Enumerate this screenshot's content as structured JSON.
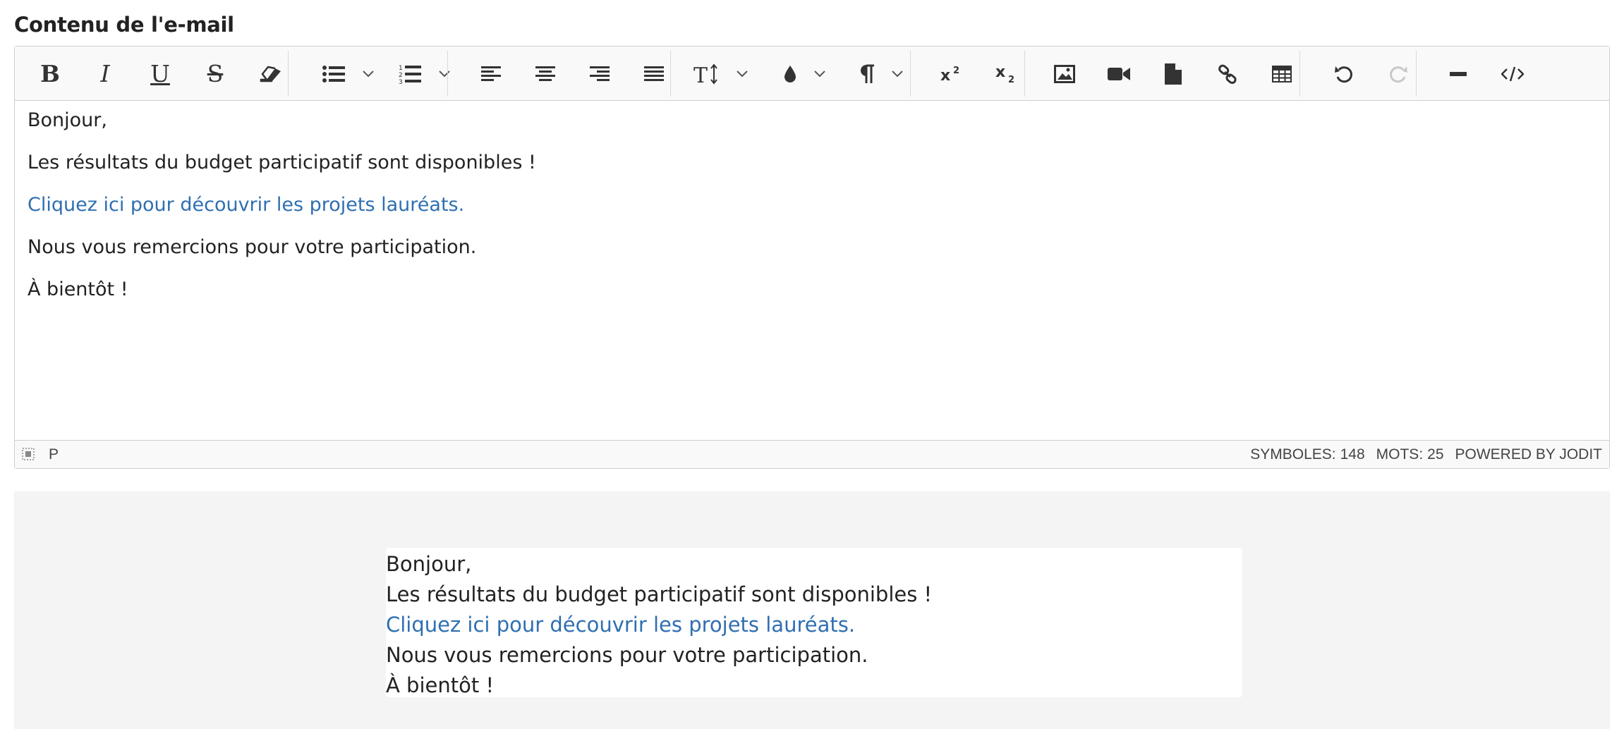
{
  "field": {
    "label": "Contenu de l'e-mail"
  },
  "toolbar": {
    "buttons": [
      {
        "name": "bold-button",
        "icon": "bold-icon",
        "glyph": "B"
      },
      {
        "name": "italic-button",
        "icon": "italic-icon",
        "glyph": "I"
      },
      {
        "name": "underline-button",
        "icon": "underline-icon",
        "glyph": "U"
      },
      {
        "name": "strikethrough-button",
        "icon": "strikethrough-icon",
        "glyph": "S"
      },
      {
        "name": "eraser-button",
        "icon": "eraser-icon"
      },
      {
        "name": "bullet-list-button",
        "icon": "bullet-list-icon",
        "dropdown": true
      },
      {
        "name": "numbered-list-button",
        "icon": "numbered-list-icon",
        "dropdown": true
      },
      {
        "name": "align-left-button",
        "icon": "align-left-icon"
      },
      {
        "name": "align-center-button",
        "icon": "align-center-icon"
      },
      {
        "name": "align-right-button",
        "icon": "align-right-icon"
      },
      {
        "name": "align-justify-button",
        "icon": "align-justify-icon"
      },
      {
        "name": "font-size-button",
        "icon": "font-size-icon",
        "dropdown": true
      },
      {
        "name": "text-color-button",
        "icon": "brush-drop-icon",
        "dropdown": true
      },
      {
        "name": "paragraph-button",
        "icon": "pilcrow-icon",
        "dropdown": true
      },
      {
        "name": "superscript-button",
        "icon": "superscript-icon"
      },
      {
        "name": "subscript-button",
        "icon": "subscript-icon"
      },
      {
        "name": "insert-image-button",
        "icon": "image-icon"
      },
      {
        "name": "insert-video-button",
        "icon": "video-icon"
      },
      {
        "name": "insert-file-button",
        "icon": "file-icon"
      },
      {
        "name": "insert-link-button",
        "icon": "link-icon"
      },
      {
        "name": "insert-table-button",
        "icon": "table-icon"
      },
      {
        "name": "undo-button",
        "icon": "undo-icon"
      },
      {
        "name": "redo-button",
        "icon": "redo-icon",
        "disabled": true
      },
      {
        "name": "horizontal-rule-button",
        "icon": "horizontal-rule-icon"
      },
      {
        "name": "source-code-button",
        "icon": "code-icon"
      }
    ]
  },
  "content": {
    "greeting": "Bonjour,",
    "line1": "Les résultats du budget participatif sont disponibles !",
    "link": "Cliquez ici pour découvrir les projets lauréats.",
    "line2": "Nous vous remercions pour votre participation.",
    "closing": "À bientôt !"
  },
  "status": {
    "path": "P",
    "symbols_label": "SYMBOLES:",
    "symbols": "148",
    "words_label": "MOTS:",
    "words": "25",
    "powered": "POWERED BY JODIT"
  },
  "preview": {
    "greeting": "Bonjour,",
    "line1": "Les résultats du budget participatif sont disponibles !",
    "link": "Cliquez ici pour découvrir les projets lauréats.",
    "line2": "Nous vous remercions pour votre participation.",
    "closing": "À bientôt !"
  },
  "colors": {
    "link": "#2f6fb1",
    "toolbar_bg": "#f9f9f9",
    "border": "#cfcfcf",
    "preview_bg": "#f4f4f4",
    "disabled_icon": "#c8c8c8"
  }
}
